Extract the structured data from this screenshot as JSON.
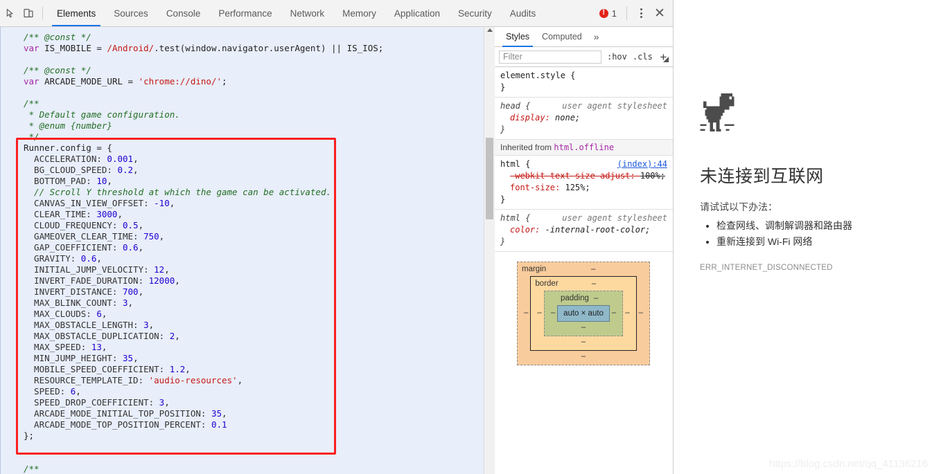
{
  "toolbar": {
    "inspect_icon": "inspect-cursor-icon",
    "device_icon": "device-toolbar-icon",
    "tabs": [
      {
        "label": "Elements",
        "active": true
      },
      {
        "label": "Sources",
        "active": false
      },
      {
        "label": "Console",
        "active": false
      },
      {
        "label": "Performance",
        "active": false
      },
      {
        "label": "Network",
        "active": false
      },
      {
        "label": "Memory",
        "active": false
      },
      {
        "label": "Application",
        "active": false
      },
      {
        "label": "Security",
        "active": false
      },
      {
        "label": "Audits",
        "active": false
      }
    ],
    "error_count": "1",
    "error_glyph": "!",
    "more_icon": "kebab-menu-icon",
    "close_label": "✕",
    "accent_color": "#1a73e8",
    "error_color": "#e2231a"
  },
  "code": {
    "highlight_color": "#fb2020",
    "background": "#e8eefa",
    "lines": [
      [
        {
          "t": "/** @const */",
          "c": "cm"
        }
      ],
      [
        {
          "t": "var ",
          "c": "kw"
        },
        {
          "t": "IS_MOBILE = ",
          "c": "id"
        },
        {
          "t": "/Android/",
          "c": "rgx"
        },
        {
          "t": ".test(window.navigator.userAgent) || IS_IOS;",
          "c": "id"
        }
      ],
      [],
      [
        {
          "t": "/** @const */",
          "c": "cm"
        }
      ],
      [
        {
          "t": "var ",
          "c": "kw"
        },
        {
          "t": "ARCADE_MODE_URL = ",
          "c": "id"
        },
        {
          "t": "'chrome://dino/'",
          "c": "str"
        },
        {
          "t": ";",
          "c": "id"
        }
      ],
      [],
      [
        {
          "t": "/**",
          "c": "cm"
        }
      ],
      [
        {
          "t": " * Default game configuration.",
          "c": "cm"
        }
      ],
      [
        {
          "t": " * @enum {number}",
          "c": "cm"
        }
      ],
      [
        {
          "t": " */",
          "c": "cm"
        }
      ],
      [
        {
          "t": "Runner",
          "c": "id"
        },
        {
          "t": ".config = {",
          "c": "id"
        }
      ],
      [
        {
          "t": "  ACCELERATION: ",
          "c": "prop"
        },
        {
          "t": "0.001",
          "c": "num"
        },
        {
          "t": ",",
          "c": "id"
        }
      ],
      [
        {
          "t": "  BG_CLOUD_SPEED: ",
          "c": "prop"
        },
        {
          "t": "0.2",
          "c": "num"
        },
        {
          "t": ",",
          "c": "id"
        }
      ],
      [
        {
          "t": "  BOTTOM_PAD: ",
          "c": "prop"
        },
        {
          "t": "10",
          "c": "num"
        },
        {
          "t": ",",
          "c": "id"
        }
      ],
      [
        {
          "t": "  // Scroll Y threshold at which the game can be activated.",
          "c": "cm"
        }
      ],
      [
        {
          "t": "  CANVAS_IN_VIEW_OFFSET: ",
          "c": "prop"
        },
        {
          "t": "-10",
          "c": "num"
        },
        {
          "t": ",",
          "c": "id"
        }
      ],
      [
        {
          "t": "  CLEAR_TIME: ",
          "c": "prop"
        },
        {
          "t": "3000",
          "c": "num"
        },
        {
          "t": ",",
          "c": "id"
        }
      ],
      [
        {
          "t": "  CLOUD_FREQUENCY: ",
          "c": "prop"
        },
        {
          "t": "0.5",
          "c": "num"
        },
        {
          "t": ",",
          "c": "id"
        }
      ],
      [
        {
          "t": "  GAMEOVER_CLEAR_TIME: ",
          "c": "prop"
        },
        {
          "t": "750",
          "c": "num"
        },
        {
          "t": ",",
          "c": "id"
        }
      ],
      [
        {
          "t": "  GAP_COEFFICIENT: ",
          "c": "prop"
        },
        {
          "t": "0.6",
          "c": "num"
        },
        {
          "t": ",",
          "c": "id"
        }
      ],
      [
        {
          "t": "  GRAVITY: ",
          "c": "prop"
        },
        {
          "t": "0.6",
          "c": "num"
        },
        {
          "t": ",",
          "c": "id"
        }
      ],
      [
        {
          "t": "  INITIAL_JUMP_VELOCITY: ",
          "c": "prop"
        },
        {
          "t": "12",
          "c": "num"
        },
        {
          "t": ",",
          "c": "id"
        }
      ],
      [
        {
          "t": "  INVERT_FADE_DURATION: ",
          "c": "prop"
        },
        {
          "t": "12000",
          "c": "num"
        },
        {
          "t": ",",
          "c": "id"
        }
      ],
      [
        {
          "t": "  INVERT_DISTANCE: ",
          "c": "prop"
        },
        {
          "t": "700",
          "c": "num"
        },
        {
          "t": ",",
          "c": "id"
        }
      ],
      [
        {
          "t": "  MAX_BLINK_COUNT: ",
          "c": "prop"
        },
        {
          "t": "3",
          "c": "num"
        },
        {
          "t": ",",
          "c": "id"
        }
      ],
      [
        {
          "t": "  MAX_CLOUDS: ",
          "c": "prop"
        },
        {
          "t": "6",
          "c": "num"
        },
        {
          "t": ",",
          "c": "id"
        }
      ],
      [
        {
          "t": "  MAX_OBSTACLE_LENGTH: ",
          "c": "prop"
        },
        {
          "t": "3",
          "c": "num"
        },
        {
          "t": ",",
          "c": "id"
        }
      ],
      [
        {
          "t": "  MAX_OBSTACLE_DUPLICATION: ",
          "c": "prop"
        },
        {
          "t": "2",
          "c": "num"
        },
        {
          "t": ",",
          "c": "id"
        }
      ],
      [
        {
          "t": "  MAX_SPEED: ",
          "c": "prop"
        },
        {
          "t": "13",
          "c": "num"
        },
        {
          "t": ",",
          "c": "id"
        }
      ],
      [
        {
          "t": "  MIN_JUMP_HEIGHT: ",
          "c": "prop"
        },
        {
          "t": "35",
          "c": "num"
        },
        {
          "t": ",",
          "c": "id"
        }
      ],
      [
        {
          "t": "  MOBILE_SPEED_COEFFICIENT: ",
          "c": "prop"
        },
        {
          "t": "1.2",
          "c": "num"
        },
        {
          "t": ",",
          "c": "id"
        }
      ],
      [
        {
          "t": "  RESOURCE_TEMPLATE_ID: ",
          "c": "prop"
        },
        {
          "t": "'audio-resources'",
          "c": "str"
        },
        {
          "t": ",",
          "c": "id"
        }
      ],
      [
        {
          "t": "  SPEED: ",
          "c": "prop"
        },
        {
          "t": "6",
          "c": "num"
        },
        {
          "t": ",",
          "c": "id"
        }
      ],
      [
        {
          "t": "  SPEED_DROP_COEFFICIENT: ",
          "c": "prop"
        },
        {
          "t": "3",
          "c": "num"
        },
        {
          "t": ",",
          "c": "id"
        }
      ],
      [
        {
          "t": "  ARCADE_MODE_INITIAL_TOP_POSITION: ",
          "c": "prop"
        },
        {
          "t": "35",
          "c": "num"
        },
        {
          "t": ",",
          "c": "id"
        }
      ],
      [
        {
          "t": "  ARCADE_MODE_TOP_POSITION_PERCENT: ",
          "c": "prop"
        },
        {
          "t": "0.1",
          "c": "num"
        }
      ],
      [
        {
          "t": "};",
          "c": "id"
        }
      ],
      [],
      [],
      [
        {
          "t": "/**",
          "c": "cm"
        }
      ]
    ]
  },
  "styles": {
    "tabs": [
      {
        "label": "Styles",
        "active": true
      },
      {
        "label": "Computed",
        "active": false
      }
    ],
    "more_label": "»",
    "filter_placeholder": "Filter",
    "filter_value": "",
    "hov_label": ":hov",
    "cls_label": ".cls",
    "plus_label": "+",
    "rules": [
      {
        "id": "element-style",
        "selector": "element.style {",
        "note": "",
        "link": "",
        "ua": false,
        "declarations": [],
        "close": "}"
      },
      {
        "id": "head-ua",
        "selector": "head {",
        "note": "user agent stylesheet",
        "link": "",
        "ua": true,
        "declarations": [
          {
            "name": "display",
            "value": "none;",
            "strike": false
          }
        ],
        "close": "}"
      },
      {
        "id": "html-index-44",
        "selector": "html {",
        "note": "",
        "link": "(index):44",
        "ua": false,
        "declarations": [
          {
            "name": "-webkit-text-size-adjust",
            "value": "100%;",
            "strike": true
          },
          {
            "name": "font-size",
            "value": "125%;",
            "strike": false
          }
        ],
        "close": "}"
      },
      {
        "id": "html-ua",
        "selector": "html {",
        "note": "user agent stylesheet",
        "link": "",
        "ua": true,
        "declarations": [
          {
            "name": "color",
            "value": "-internal-root-color;",
            "strike": false
          }
        ],
        "close": "}"
      }
    ],
    "inherited_label": "Inherited from",
    "inherited_from": "html.offline"
  },
  "box_model": {
    "margin_label": "margin",
    "border_label": "border",
    "padding_label": "padding",
    "content_label": "auto × auto",
    "dash": "–",
    "colors": {
      "margin": "#f9cc9d",
      "border": "#fdd9a0",
      "padding": "#bfcb8d",
      "content": "#8fb8c9"
    }
  },
  "offline_page": {
    "dino_icon": "dino-t-rex-icon",
    "title": "未连接到互联网",
    "subtitle": "请试试以下办法：",
    "suggestions": [
      "检查网线、调制解调器和路由器",
      "重新连接到 Wi-Fi 网络"
    ],
    "error_code": "ERR_INTERNET_DISCONNECTED"
  },
  "watermark": {
    "text": "https://blog.csdn.net/qq_41136216"
  }
}
